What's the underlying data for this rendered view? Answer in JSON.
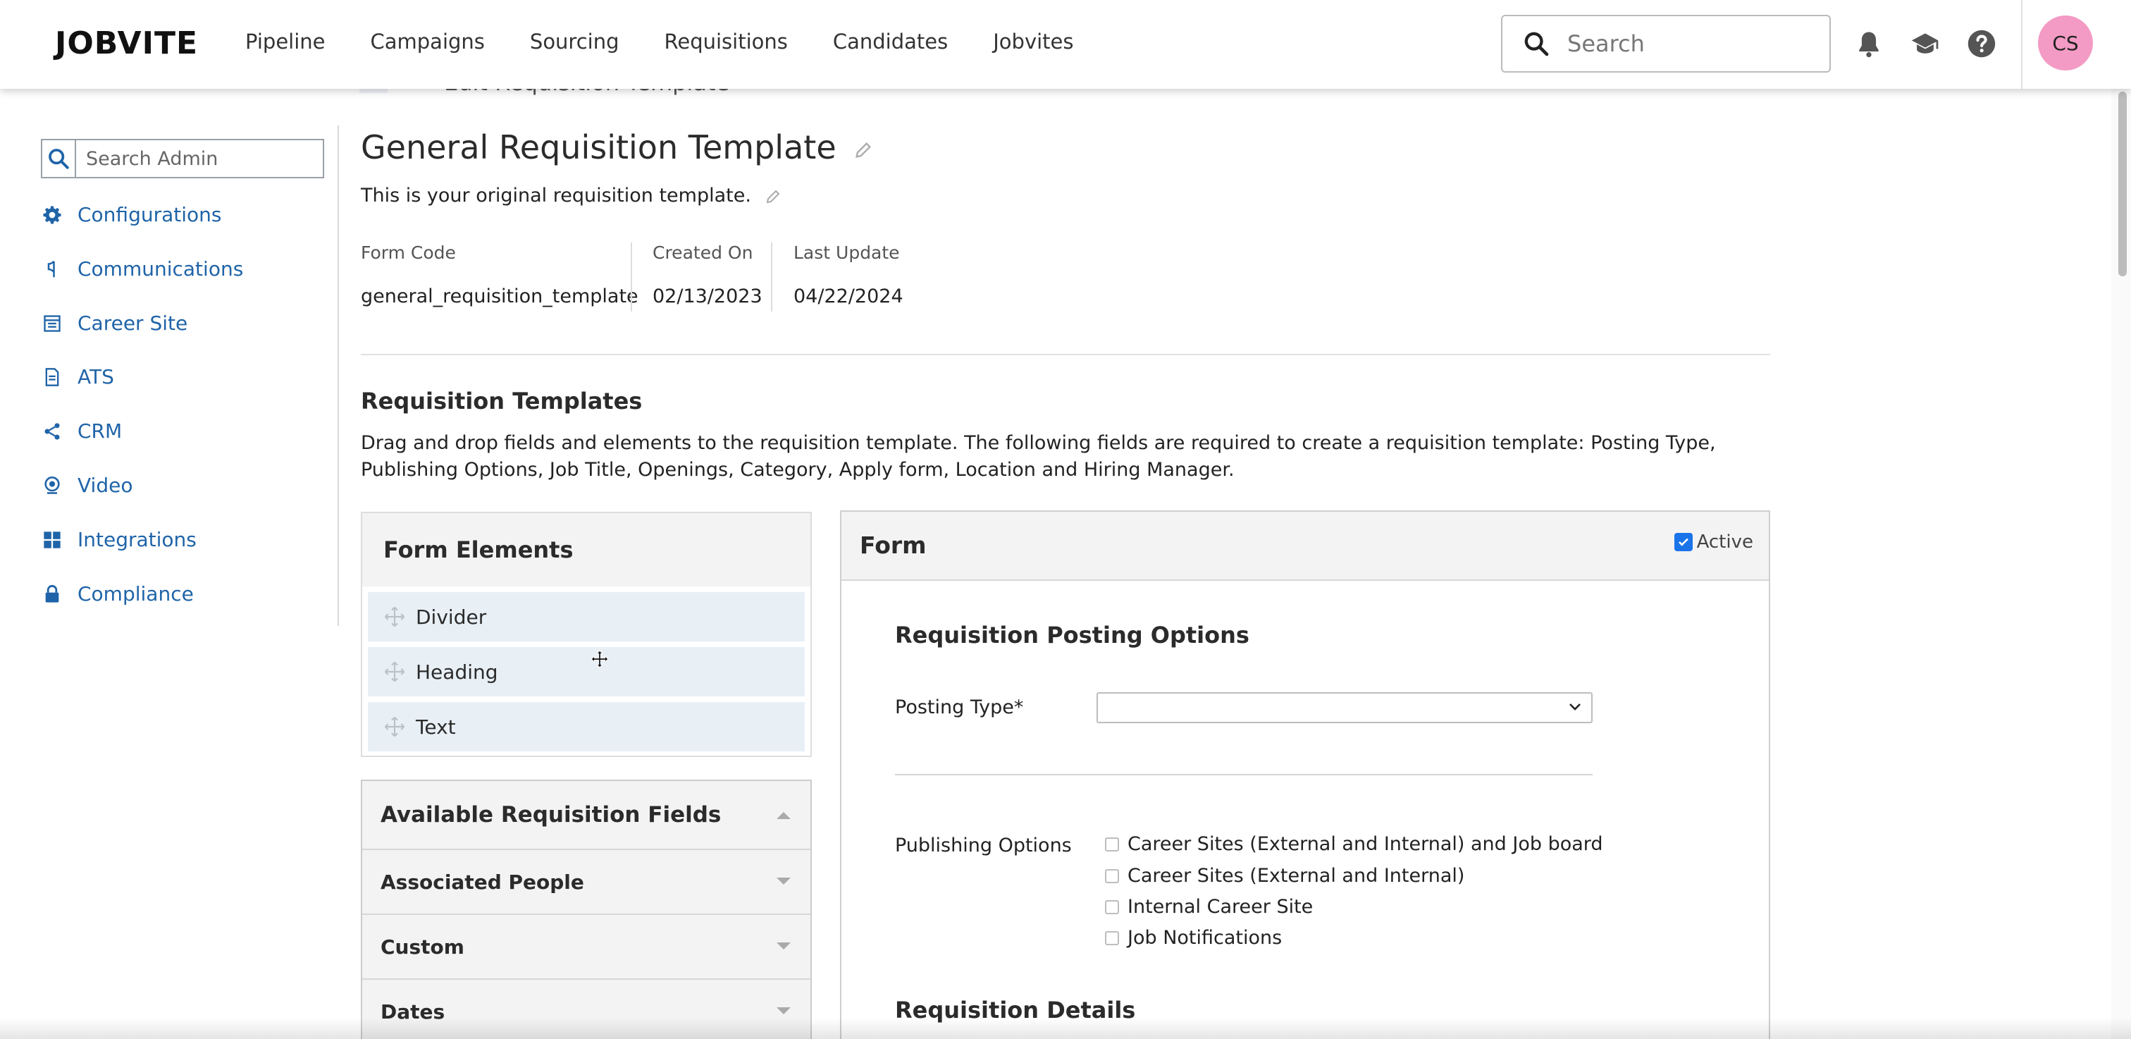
{
  "app": {
    "logo": "JOBVITE",
    "nav": [
      "Pipeline",
      "Campaigns",
      "Sourcing",
      "Requisitions",
      "Candidates",
      "Jobvites"
    ],
    "search_placeholder": "Search",
    "avatar_initials": "CS"
  },
  "breadcrumb": {
    "current": "Edit Requisition Template"
  },
  "sidebar": {
    "search_placeholder": "Search Admin",
    "items": [
      {
        "label": "Configurations",
        "icon": "gear-icon"
      },
      {
        "label": "Communications",
        "icon": "megaphone-icon"
      },
      {
        "label": "Career Site",
        "icon": "page-icon"
      },
      {
        "label": "ATS",
        "icon": "document-icon"
      },
      {
        "label": "CRM",
        "icon": "share-icon"
      },
      {
        "label": "Video",
        "icon": "webcam-icon"
      },
      {
        "label": "Integrations",
        "icon": "grid-icon"
      },
      {
        "label": "Compliance",
        "icon": "lock-icon"
      }
    ],
    "accent_color": "#1f64a8"
  },
  "template": {
    "title": "General Requisition Template",
    "description": "This is your original requisition template.",
    "meta": [
      {
        "label": "Form Code",
        "value": "general_requisition_template"
      },
      {
        "label": "Created On",
        "value": "02/13/2023"
      },
      {
        "label": "Last Update",
        "value": "04/22/2024"
      }
    ]
  },
  "requisition_templates": {
    "heading": "Requisition Templates",
    "instructions": "Drag and drop fields and elements to the requisition template. The following fields are required to create a requisition template: Posting Type, Publishing Options, Job Title, Openings, Category, Apply form, Location and Hiring Manager."
  },
  "form_elements": {
    "heading": "Form Elements",
    "items": [
      "Divider",
      "Heading",
      "Text"
    ]
  },
  "available_fields": {
    "heading": "Available Requisition Fields",
    "groups": [
      "Associated People",
      "Custom",
      "Dates"
    ]
  },
  "form": {
    "heading": "Form",
    "active_label": "Active",
    "active_checked": true,
    "section1": "Requisition Posting Options",
    "posting_type_label": "Posting Type*",
    "posting_type_value": "",
    "publishing_label": "Publishing Options",
    "publishing_options": [
      "Career Sites (External and Internal) and Job board",
      "Career Sites (External and Internal)",
      "Internal Career Site",
      "Job Notifications"
    ],
    "section2": "Requisition Details"
  }
}
